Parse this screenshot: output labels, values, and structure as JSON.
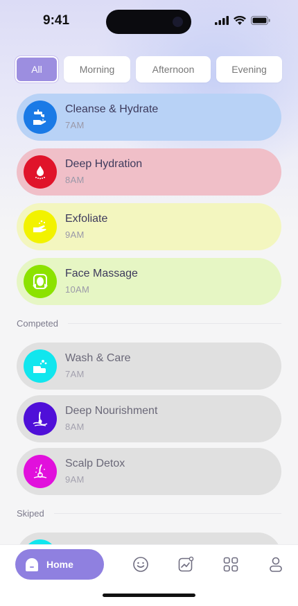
{
  "status": {
    "time": "9:41"
  },
  "filters": [
    "All",
    "Morning",
    "Afternoon",
    "Evening"
  ],
  "tasks": [
    {
      "title": "Cleanse & Hydrate",
      "time": "7AM",
      "icon": "faucet-icon",
      "color": "#1a7ae6",
      "bg": "#b8d2f6"
    },
    {
      "title": "Deep Hydration",
      "time": "8AM",
      "icon": "water-drop-icon",
      "color": "#e0142a",
      "bg": "#f0bfc8"
    },
    {
      "title": "Exfoliate",
      "time": "9AM",
      "icon": "exfoliate-hand-icon",
      "color": "#f2f200",
      "bg": "#f3f6bf"
    },
    {
      "title": "Face Massage",
      "time": "10AM",
      "icon": "face-massage-icon",
      "color": "#8ce200",
      "bg": "#e6f6c4"
    }
  ],
  "sections": {
    "completed": "Competed",
    "skipped": "Skiped"
  },
  "completed": [
    {
      "title": "Wash & Care",
      "time": "7AM",
      "icon": "wash-hand-icon",
      "color": "#11e6ee"
    },
    {
      "title": "Deep Nourishment",
      "time": "8AM",
      "icon": "hair-root-icon",
      "color": "#4f0fd8"
    },
    {
      "title": "Scalp Detox",
      "time": "9AM",
      "icon": "scalp-icon",
      "color": "#e110dc"
    }
  ],
  "nav": {
    "home_label": "Home"
  }
}
